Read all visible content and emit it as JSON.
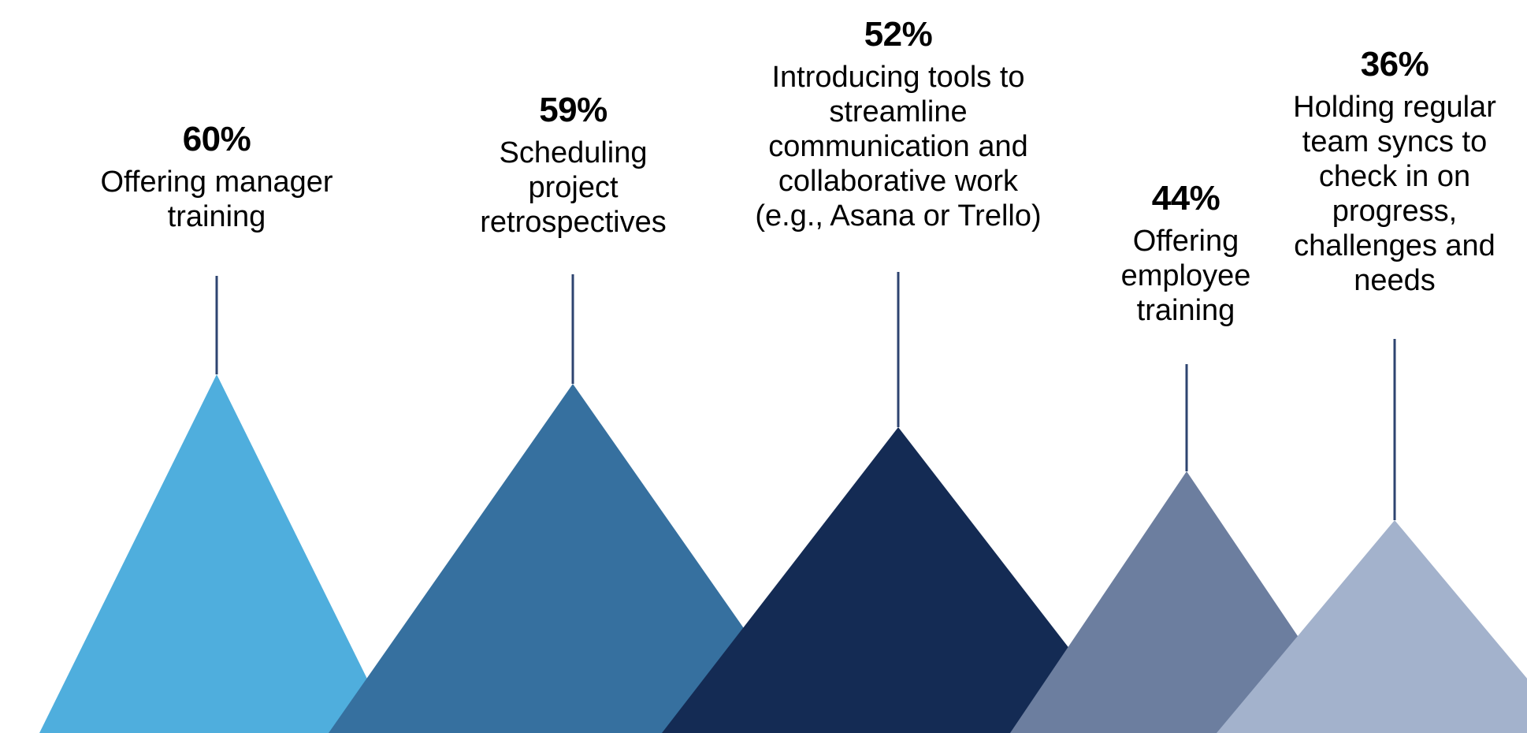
{
  "chart_data": {
    "type": "bar",
    "subtype": "triangle-pictograph",
    "title": "",
    "subtitle": "",
    "xlabel": "",
    "ylabel": "",
    "ylim": [
      0,
      60
    ],
    "grid": false,
    "legend": "none",
    "units": "percent",
    "categories": [
      "Offering manager training",
      "Scheduling project retrospectives",
      "Introducing tools to streamline communication and collaborative work (e.g., Asana or Trello)",
      "Offering employee training",
      "Holding regular team syncs to check in on progress, challenges and needs"
    ],
    "values": [
      60,
      59,
      52,
      44,
      36
    ],
    "value_labels": [
      "60%",
      "59%",
      "52%",
      "44%",
      "36%"
    ],
    "colors": [
      "#4FAEDD",
      "#36709F",
      "#142B54",
      "#6C7E9F",
      "#A3B2CC"
    ]
  },
  "items": [
    {
      "value_label": "60%",
      "value": 60,
      "description_lines": [
        "Offering manager",
        "training"
      ],
      "color": "#4FAEDD",
      "leader_line_color": "#2E4470"
    },
    {
      "value_label": "59%",
      "value": 59,
      "description_lines": [
        "Scheduling",
        "project",
        "retrospectives"
      ],
      "color": "#36709F",
      "leader_line_color": "#2E4470"
    },
    {
      "value_label": "52%",
      "value": 52,
      "description_lines": [
        "Introducing tools to",
        "streamline",
        "communication and",
        "collaborative work",
        "(e.g., Asana or Trello)"
      ],
      "color": "#142B54",
      "leader_line_color": "#2E4470"
    },
    {
      "value_label": "44%",
      "value": 44,
      "description_lines": [
        "Offering",
        "employee",
        "training"
      ],
      "color": "#6C7E9F",
      "leader_line_color": "#2E4470"
    },
    {
      "value_label": "36%",
      "value": 36,
      "description_lines": [
        "Holding regular",
        "team syncs to",
        "check in on",
        "progress,",
        "challenges and",
        "needs"
      ],
      "color": "#A3B2CC",
      "leader_line_color": "#2E4470"
    }
  ]
}
